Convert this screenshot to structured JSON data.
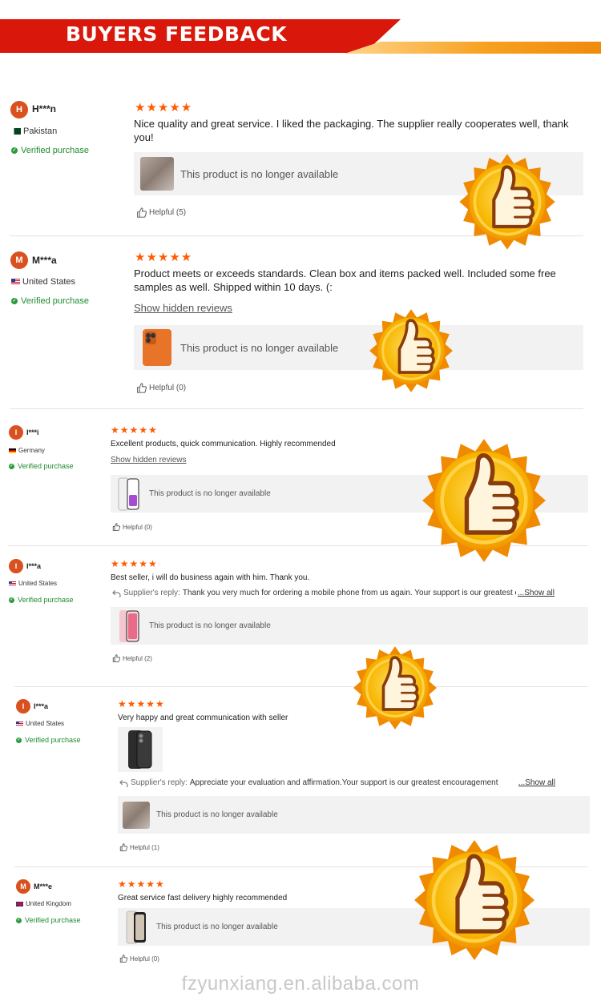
{
  "header": {
    "title": "BUYERS FEEDBACK"
  },
  "colors": {
    "accent_red": "#d9170b",
    "star": "#ff5a00",
    "verified": "#1f8c2e",
    "badge_gold": "#f7b500"
  },
  "reviews": [
    {
      "initial": "H",
      "name": "H***n",
      "country": "Pakistan",
      "flag": "pakistan-flag",
      "verified": "Verified purchase",
      "rating": 5,
      "stars": "★★★★★",
      "text": "Nice quality and great service. I liked the packaging. The supplier really cooperates well, thank you!",
      "product_text": "This product is no longer available",
      "product_icon": "blurred-product-thumbnail",
      "helpful": "Helpful (5)"
    },
    {
      "initial": "M",
      "name": "M***a",
      "country": "United States",
      "flag": "us-flag",
      "verified": "Verified purchase",
      "rating": 5,
      "stars": "★★★★★",
      "text": "Product meets or exceeds standards. Clean box and items packed well. Included some free samples as well. Shipped within 10 days. (:",
      "hidden_link": "Show hidden reviews",
      "product_text": "This product is no longer available",
      "product_icon": "orange-phone-thumbnail",
      "helpful": "Helpful (0)"
    },
    {
      "initial": "I",
      "name": "I***i",
      "country": "Germany",
      "flag": "germany-flag",
      "verified": "Verified purchase",
      "rating": 5,
      "stars": "★★★★★",
      "text": "Excellent products, quick communication. Highly recommended",
      "hidden_link": "Show hidden reviews",
      "product_text": "This product is no longer available",
      "product_icon": "phone-thumbnail",
      "helpful": "Helpful (0)"
    },
    {
      "initial": "I",
      "name": "I***a",
      "country": "United States",
      "flag": "us-flag",
      "verified": "Verified purchase",
      "rating": 5,
      "stars": "★★★★★",
      "text": "Best seller, i will do business again with him. Thank you.",
      "reply_label": "Supplier's reply:",
      "reply_text": "Thank you very much for ordering a mobile phone from us again. Your support is our greatest encouragement",
      "reply_more": "...Show all",
      "product_text": "This product is no longer available",
      "product_icon": "pink-phone-thumbnail",
      "helpful": "Helpful (2)"
    },
    {
      "initial": "I",
      "name": "I***a",
      "country": "United States",
      "flag": "us-flag",
      "verified": "Verified purchase",
      "rating": 5,
      "stars": "★★★★★",
      "text": "Very happy and great communication with seller",
      "photo_icon": "black-phone-photo",
      "reply_label": "Supplier's reply:",
      "reply_text": "Appreciate your evaluation and affirmation.Your support is our greatest encouragement",
      "reply_more": "...Show all",
      "product_text": "This product is no longer available",
      "product_icon": "blurred-product-thumbnail",
      "helpful": "Helpful (1)"
    },
    {
      "initial": "M",
      "name": "M***e",
      "country": "United Kingdom",
      "flag": "uk-flag",
      "verified": "Verified purchase",
      "rating": 5,
      "stars": "★★★★★",
      "text": "Great service fast delivery highly recommended",
      "product_text": "This product is no longer available",
      "product_icon": "titanium-phone-thumbnail",
      "helpful": "Helpful (0)"
    }
  ],
  "decorations": {
    "badge_icon": "thumbs-up-badge-icon"
  },
  "watermark": "fzyunxiang.en.alibaba.com"
}
